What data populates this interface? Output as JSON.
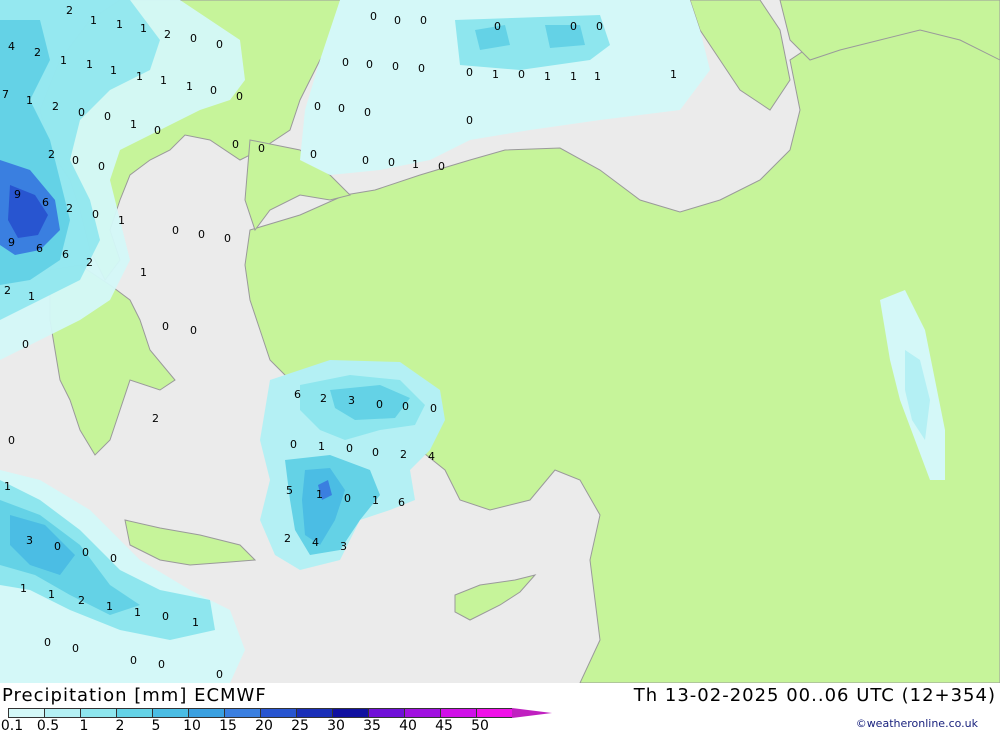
{
  "header": {
    "title": "Precipitation [mm] ECMWF",
    "timestamp": "Th 13-02-2025 00..06 UTC (12+354)",
    "credit": "©weatheronline.co.uk"
  },
  "legend": {
    "labels": [
      "0.1",
      "0.5",
      "1",
      "2",
      "5",
      "10",
      "15",
      "20",
      "25",
      "30",
      "35",
      "40",
      "45",
      "50"
    ],
    "colors": [
      "#d4f8f8",
      "#b4f0f4",
      "#8ee6ee",
      "#64d2e6",
      "#4bbde4",
      "#3aa0e0",
      "#3a7fe0",
      "#2855d0",
      "#1a2fb8",
      "#1010a0",
      "#7010d8",
      "#a010e0",
      "#d010e8",
      "#f010e8",
      "#c020c0"
    ]
  },
  "map": {
    "colors": {
      "sea": "#ebebeb",
      "land": "#c6f49a",
      "border": "#9a9a9a"
    },
    "values": [
      "2",
      "1",
      "1",
      "1",
      "2",
      "0",
      "0",
      "4",
      "2",
      "1",
      "1",
      "1",
      "1",
      "1",
      "1",
      "0",
      "0",
      "7",
      "1",
      "2",
      "0",
      "0",
      "1",
      "0",
      "0",
      "0",
      "2",
      "0",
      "0",
      "9",
      "6",
      "2",
      "0",
      "1",
      "9",
      "6",
      "6",
      "2",
      "1",
      "2",
      "1",
      "0",
      "0",
      "0",
      "0",
      "0",
      "0",
      "0",
      "0",
      "0",
      "0",
      "0",
      "0",
      "0",
      "0",
      "0",
      "0",
      "0",
      "0",
      "0",
      "0",
      "1",
      "0",
      "1",
      "1",
      "1",
      "1",
      "0",
      "0",
      "0",
      "0",
      "1",
      "0",
      "6",
      "2",
      "3",
      "0",
      "0",
      "0",
      "0",
      "1",
      "0",
      "0",
      "2",
      "4",
      "5",
      "1",
      "0",
      "1",
      "6",
      "2",
      "4",
      "3",
      "3",
      "0",
      "0",
      "0",
      "1",
      "1",
      "2",
      "1",
      "1",
      "0",
      "1",
      "0",
      "0",
      "0",
      "0",
      "0",
      "0",
      "1",
      "2"
    ]
  }
}
